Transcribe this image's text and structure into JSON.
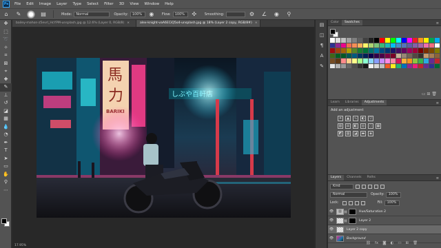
{
  "menubar": {
    "logo": "Ps",
    "items": [
      "File",
      "Edit",
      "Image",
      "Layer",
      "Type",
      "Select",
      "Filter",
      "3D",
      "View",
      "Window",
      "Help"
    ]
  },
  "options": {
    "mode_label": "Mode:",
    "mode_value": "Normal",
    "opacity_label": "Opacity:",
    "opacity_value": "100%",
    "flow_label": "Flow:",
    "flow_value": "100%",
    "smoothing_label": "Smoothing:",
    "smoothing_value": ""
  },
  "tabs": [
    {
      "label": "bailey-mahon-z5evrl_HcYPM-unsplash.jpg @ 12.6% (Layer 0, RGB/8)",
      "close": "×"
    },
    {
      "label": "alex-knight-vaA6ECiQ5o4-unsplash.jpg @ 18% (Layer 2 copy, RGB/8#)",
      "close": "×"
    }
  ],
  "canvas": {
    "zoom": "17.95%"
  },
  "panels": {
    "top_tabs": [
      "Color",
      "Swatches"
    ],
    "adj_tabs": [
      "Learn",
      "Libraries",
      "Adjustments"
    ],
    "adj_add_label": "Add an adjustment",
    "layers_tabs": [
      "Layers",
      "Channels",
      "Paths"
    ],
    "kind_label": "Kind",
    "blend_mode": "Normal",
    "opacity_label": "Opacity:",
    "opacity_value": "100%",
    "lock_label": "Lock:",
    "fill_label": "Fill:",
    "fill_value": "100%"
  },
  "layers": [
    {
      "name": "Hue/Saturation 2",
      "type": "adjustment",
      "selected": false
    },
    {
      "name": "Layer 2",
      "type": "masked",
      "selected": false
    },
    {
      "name": "Layer 2 copy",
      "type": "checker",
      "selected": true
    },
    {
      "name": "Background",
      "type": "photo",
      "selected": false
    }
  ],
  "swatches": [
    "#ffffff",
    "#e0e0e0",
    "#c0c0c0",
    "#a0a0a0",
    "#808080",
    "#606060",
    "#404040",
    "#202020",
    "#000000",
    "#ff0000",
    "#ffff00",
    "#00ff00",
    "#00ffff",
    "#0000ff",
    "#ff00ff",
    "#ed1c24",
    "#f7941d",
    "#fff200",
    "#00a651",
    "#00aeef",
    "#2e3192",
    "#92278f",
    "#ec008c",
    "#f26c4f",
    "#f68e56",
    "#fbaf5d",
    "#fff568",
    "#acd372",
    "#7cc576",
    "#3bb878",
    "#1abbb4",
    "#00bff3",
    "#438ccb",
    "#5574b9",
    "#605ca8",
    "#855fa8",
    "#a763a8",
    "#f06eaa",
    "#f26d7d",
    "#ffffff",
    "#9e0b0f",
    "#a0410d",
    "#a36209",
    "#aba000",
    "#598527",
    "#1a7b30",
    "#007236",
    "#00746b",
    "#0076a3",
    "#004b80",
    "#003471",
    "#1b1464",
    "#440e62",
    "#630460",
    "#9e005d",
    "#9e0039",
    "#790000",
    "#7b2e00",
    "#7d4900",
    "#827b00",
    "#406618",
    "#005e20",
    "#005826",
    "#005952",
    "#005b7f",
    "#003663",
    "#002157",
    "#0d004c",
    "#32004b",
    "#4b0049",
    "#7b0046",
    "#7a0026",
    "#c7b299",
    "#998675",
    "#736357",
    "#534741",
    "#37302d",
    "#c69c6d",
    "#a67c52",
    "#8c6239",
    "#754c24",
    "#603913",
    "#ff8a8a",
    "#ffcf8a",
    "#fffe8a",
    "#a8ff8a",
    "#8affd0",
    "#8ad5ff",
    "#8a9dff",
    "#c88aff",
    "#ff8ae5",
    "#ff8aa8",
    "#d4145a",
    "#fbb03b",
    "#f7931e",
    "#8cc63f",
    "#39b54a",
    "#29abe2",
    "#662d91",
    "#c1272d",
    "#e6e6e6",
    "#b3b3b3",
    "#999999",
    "#666666",
    "#4d4d4d",
    "#333333",
    "#1a1a1a",
    "#f2f2f2",
    "#d9d9d9",
    "#bfbfbf",
    "#f15a24",
    "#fcee21",
    "#22b573",
    "#0071bc",
    "#93278f",
    "#ed1e79",
    "#c1272d",
    "#662d91",
    "#2e3192",
    "#006837"
  ]
}
